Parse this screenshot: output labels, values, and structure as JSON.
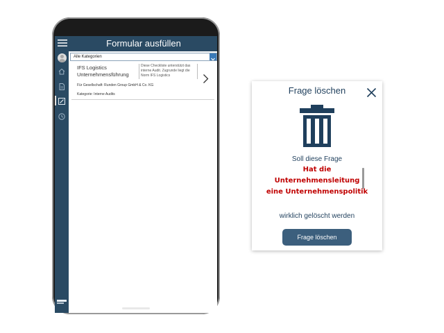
{
  "app": {
    "title": "Formular ausfüllen",
    "filter": {
      "value": "Alle Kategorien",
      "icon": "chevron-down-icon"
    },
    "card": {
      "title": "IFS Logistics Unternehmensführung",
      "description": "Diese Checkliste unterstützt das interne Audit. Zugrunde liegt die Norm IFS Logistics",
      "company": "Für Gesellschaft: Runden Group GmbH & Co. KG",
      "category": "Kategorie: Interne Audits"
    },
    "sidebar": {
      "icons": [
        "home-icon",
        "document-icon",
        "edit-form-icon",
        "history-icon"
      ]
    }
  },
  "dialog": {
    "title": "Frage löschen",
    "question": "Soll diese Frage",
    "question_text": "Hat die Unternehmensleitung eine Unternehmenspolitik",
    "confirm": "wirklich gelöscht werden",
    "button_label": "Frage löschen"
  },
  "colors": {
    "header": "#2a4a63",
    "accent_text": "#1f3f5c",
    "question_red": "#c00000",
    "button": "#3c5f7d"
  }
}
